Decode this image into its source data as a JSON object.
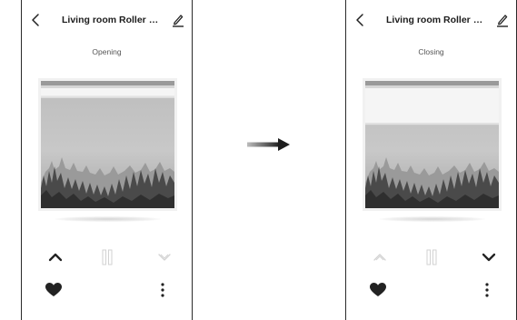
{
  "left_screen": {
    "title": "Living room Roller Sh...",
    "status": "Opening",
    "shade_fraction": 0.12,
    "up_enabled": true,
    "down_enabled": false,
    "icons": [
      "back-icon",
      "edit-icon",
      "chevron-up-icon",
      "pause-icon",
      "chevron-down-icon",
      "heart-icon",
      "more-vertical-icon"
    ]
  },
  "right_screen": {
    "title": "Living room Roller Sh...",
    "status": "Closing",
    "shade_fraction": 0.33,
    "up_enabled": false,
    "down_enabled": true,
    "icons": [
      "back-icon",
      "edit-icon",
      "chevron-up-icon",
      "pause-icon",
      "chevron-down-icon",
      "heart-icon",
      "more-vertical-icon"
    ]
  },
  "transition_arrow": "arrow-right-icon",
  "colors": {
    "icon_active": "#222222",
    "icon_disabled": "#d2d2d2",
    "shade": "#f5f5f5",
    "border": "#2a2a2a"
  }
}
